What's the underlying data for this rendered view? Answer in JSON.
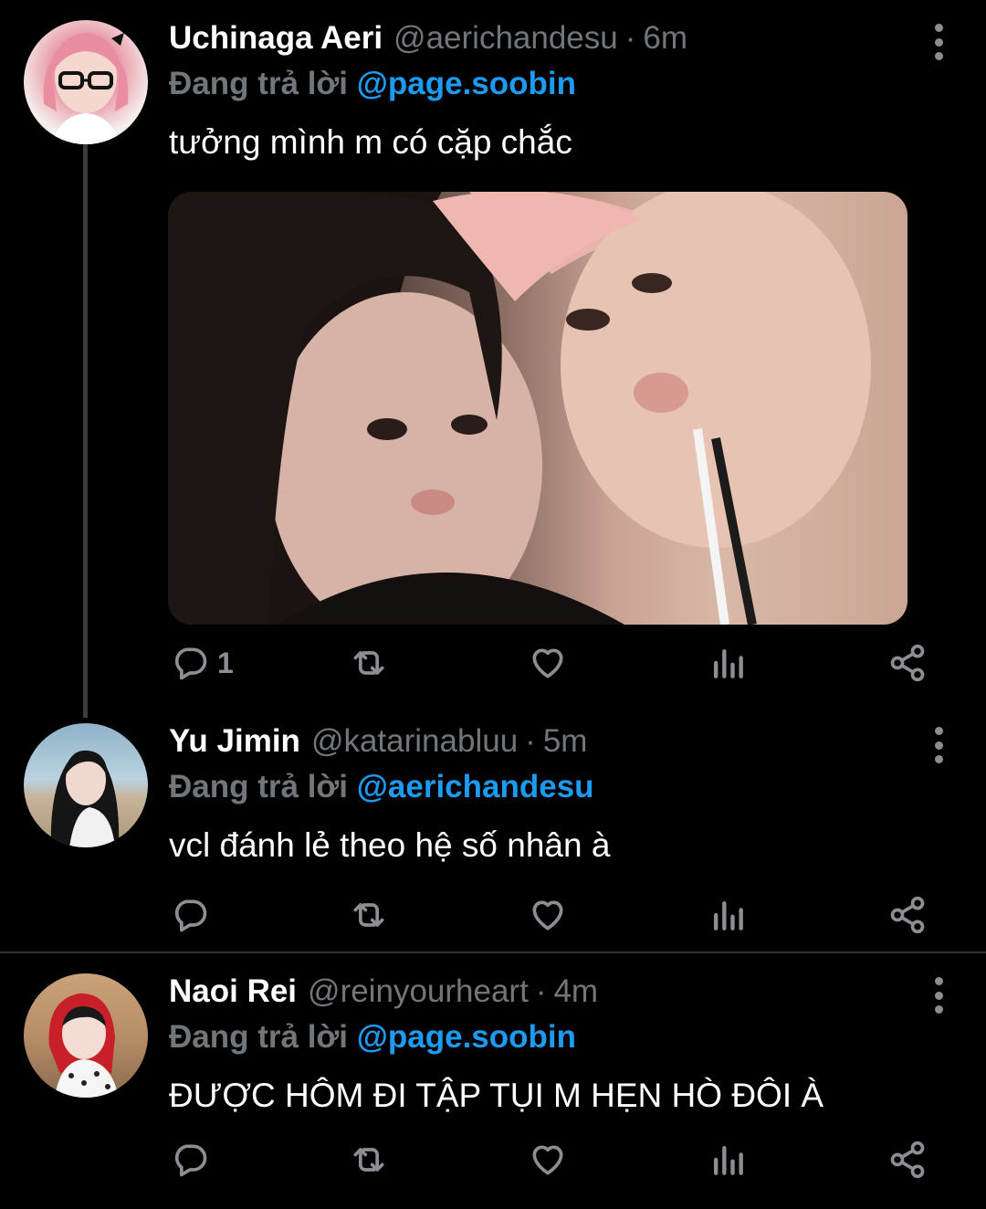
{
  "tweets": [
    {
      "name": "Uchinaga Aeri",
      "handle": "@aerichandesu",
      "separator": "·",
      "time": "6m",
      "reply_prefix": "Đang trả lời",
      "reply_mention": "@page.soobin",
      "text": "tưởng mình m có cặp chắc",
      "reply_count": "1"
    },
    {
      "name": "Yu Jimin",
      "handle": "@katarinabluu",
      "separator": "·",
      "time": "5m",
      "reply_prefix": "Đang trả lời",
      "reply_mention": "@aerichandesu",
      "text": "vcl đánh lẻ theo hệ số nhân à",
      "reply_count": ""
    },
    {
      "name": "Naoi Rei",
      "handle": "@reinyourheart",
      "separator": "·",
      "time": "4m",
      "reply_prefix": "Đang trả lời",
      "reply_mention": "@page.soobin",
      "text": "ĐƯỢC HÔM ĐI TẬP TỤI M HẸN HÒ ĐÔI À",
      "reply_count": ""
    }
  ],
  "icons": {
    "reply": "reply-icon",
    "retweet": "retweet-icon",
    "like": "heart-icon",
    "views": "analytics-icon",
    "share": "share-icon",
    "more": "more-vertical-icon"
  },
  "colors": {
    "background": "#000000",
    "text": "#ffffff",
    "muted": "#71767b",
    "link": "#1d9bf0",
    "divider": "#2f3336"
  }
}
